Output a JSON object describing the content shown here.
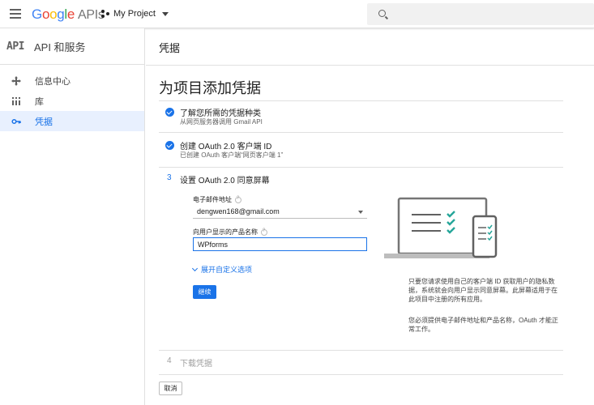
{
  "header": {
    "brand": [
      "G",
      "o",
      "o",
      "g",
      "l",
      "e"
    ],
    "apis": "APIs",
    "project": "My Project",
    "colors": {
      "blue": "#4285f4",
      "red": "#ea4335",
      "yellow": "#fbbc05",
      "green": "#34a853"
    }
  },
  "sidebar": {
    "badge": "API",
    "title": "API 和服务",
    "items": [
      {
        "label": "信息中心",
        "icon": "dashboard-icon"
      },
      {
        "label": "库",
        "icon": "library-icon"
      },
      {
        "label": "凭据",
        "icon": "key-icon",
        "active": true
      }
    ]
  },
  "main": {
    "crumb": "凭据",
    "title": "为项目添加凭据",
    "steps": [
      {
        "title": "了解您所需的凭据种类",
        "sub": "从网页服务器调用 Gmail API",
        "done": true
      },
      {
        "title": "创建 OAuth 2.0 客户端 ID",
        "sub": "已创建 OAuth 客户端“网页客户端 1”",
        "done": true
      },
      {
        "num": "3",
        "title": "设置 OAuth 2.0 同意屏幕"
      },
      {
        "num": "4",
        "title": "下载凭据"
      }
    ],
    "email_label": "电子邮件地址",
    "email_value": "dengwen168@gmail.com",
    "product_label": "向用户显示的产品名称",
    "product_value": "WPforms",
    "expand_label": "展开自定义选项",
    "continue_label": "继续",
    "note1": "只要您请求使用自己的客户端 ID 获取用户的隐私数据，系统就会向用户显示同意屏幕。此屏幕适用于在此项目中注册的所有应用。",
    "note2": "您必须提供电子邮件地址和产品名称，OAuth 才能正常工作。",
    "cancel_label": "取消",
    "accent": "#1a73e8"
  }
}
